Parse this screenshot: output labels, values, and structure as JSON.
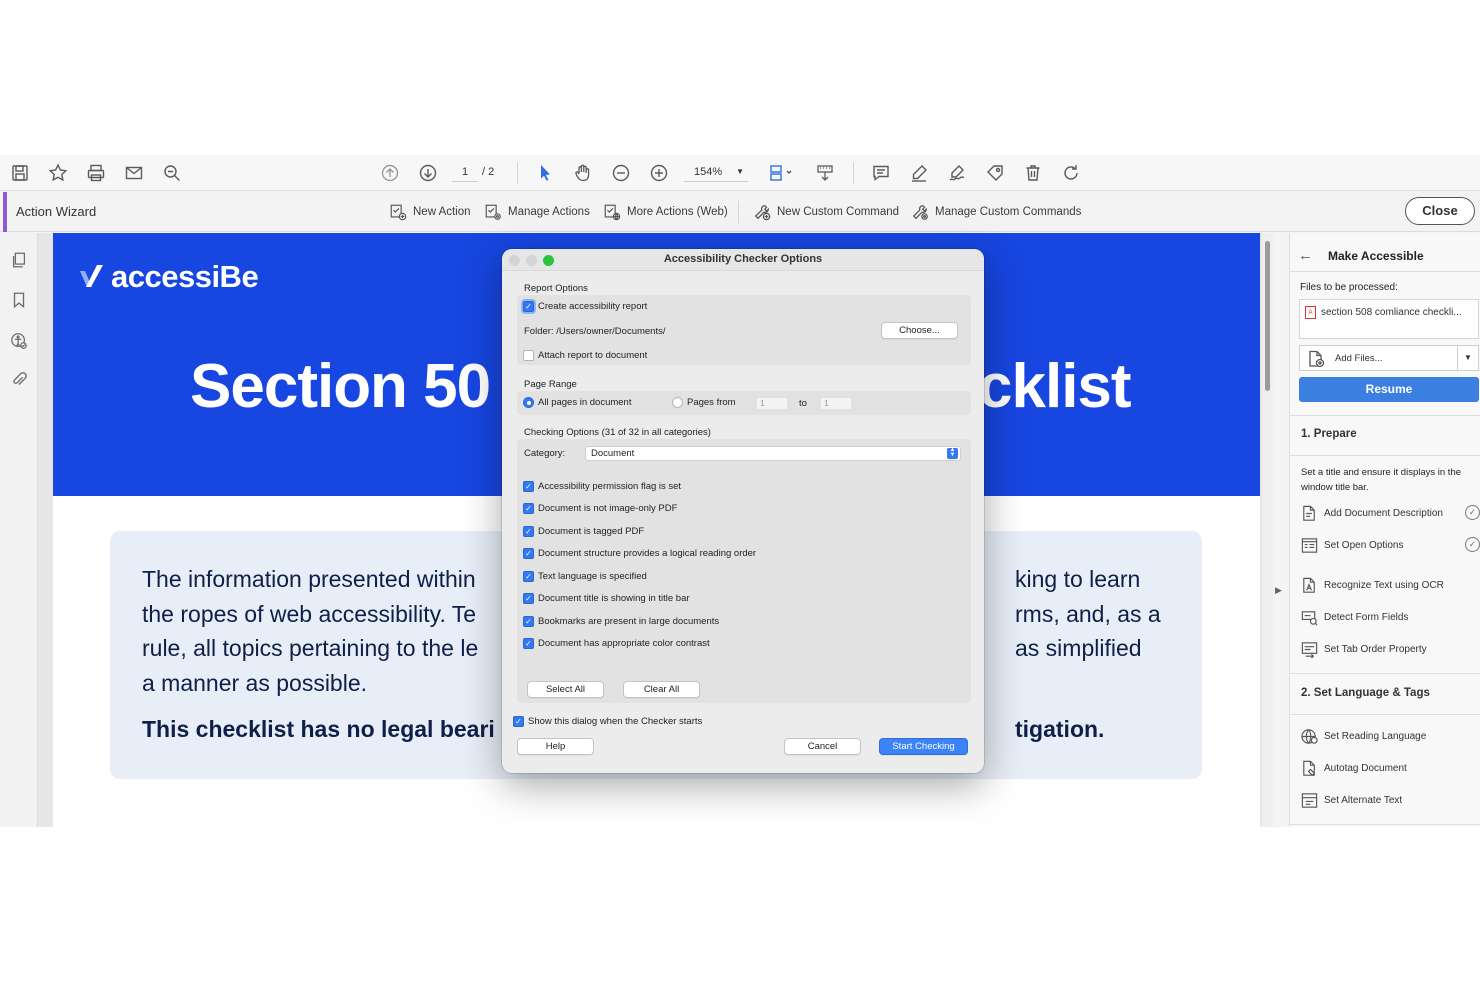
{
  "toolbar": {
    "page_current": "1",
    "page_total": "/ 2",
    "zoom": "154%"
  },
  "action_wizard": {
    "title": "Action Wizard",
    "items": [
      "New Action",
      "Manage Actions",
      "More Actions (Web)",
      "New Custom Command",
      "Manage Custom Commands"
    ],
    "close_label": "Close"
  },
  "document": {
    "logo_text": "accessiBe",
    "hero_title_left": "Section 50",
    "hero_title_right": "cklist",
    "paragraph_left": [
      "The information presented within",
      "the ropes of web accessibility. Te",
      "rule, all topics pertaining to the le",
      "a manner as possible."
    ],
    "paragraph_right": [
      "king to learn",
      "rms, and, as a",
      "as simplified",
      ""
    ],
    "bold_left": "This checklist has no legal beari",
    "bold_right": "tigation."
  },
  "dialog": {
    "title": "Accessibility Checker Options",
    "report_options_label": "Report Options",
    "create_report_label": "Create accessibility report",
    "folder_text": "Folder: /Users/owner/Documents/",
    "choose_label": "Choose...",
    "attach_report_label": "Attach report to document",
    "page_range_label": "Page Range",
    "all_pages_label": "All pages in document",
    "pages_from_label": "Pages from",
    "pages_from_value": "1",
    "to_label": "to",
    "pages_to_value": "1",
    "checking_options_label": "Checking Options (31 of 32 in all categories)",
    "category_label": "Category:",
    "category_value": "Document",
    "checks": [
      "Accessibility permission flag is set",
      "Document is not image-only PDF",
      "Document is tagged PDF",
      "Document structure provides a logical reading order",
      "Text language is specified",
      "Document title is showing in title bar",
      "Bookmarks are present in large documents",
      "Document has appropriate color contrast"
    ],
    "select_all_label": "Select All",
    "clear_all_label": "Clear All",
    "show_dialog_label": "Show this dialog when the Checker starts",
    "help_label": "Help",
    "cancel_label": "Cancel",
    "start_label": "Start Checking"
  },
  "right_panel": {
    "title": "Make Accessible",
    "files_label": "Files to be processed:",
    "file_name": "section 508 comliance checkli...",
    "add_files_label": "Add Files...",
    "resume_label": "Resume",
    "prepare_header": "1. Prepare",
    "prepare_desc": "Set a title and ensure it displays in the window title bar.",
    "prepare_items": [
      "Add Document Description",
      "Set Open Options",
      "Recognize Text using OCR",
      "Detect Form Fields",
      "Set Tab Order Property"
    ],
    "language_header": "2. Set Language & Tags",
    "language_items": [
      "Set Reading Language",
      "Autotag Document",
      "Set Alternate Text"
    ]
  },
  "colors": {
    "hero_blue": "#1746e0",
    "accent_purple": "#8a5bd1",
    "resume_blue": "#3b7fe0",
    "checkbox_blue": "#3478f6"
  }
}
